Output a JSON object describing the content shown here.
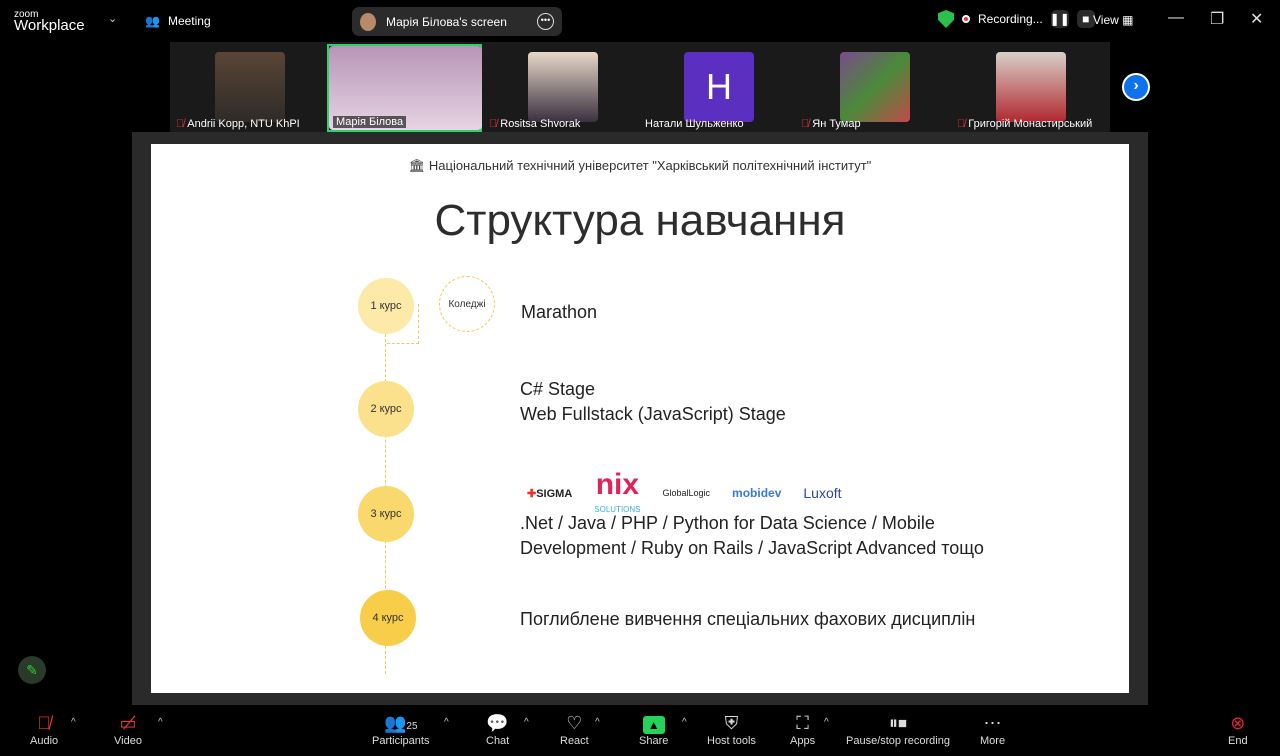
{
  "app": {
    "brand_small": "zoom",
    "brand_big": "Workplace",
    "meeting_label": "Meeting",
    "screen_label": "Марія Білова's screen",
    "recording_label": "Recording...",
    "view_label": "View"
  },
  "participants": [
    {
      "name": "Andrii Kopp, NTU KhPI",
      "muted": true,
      "initial": ""
    },
    {
      "name": "Марія Білова",
      "muted": false,
      "initial": ""
    },
    {
      "name": "Rositsa Shvorak",
      "muted": true,
      "initial": ""
    },
    {
      "name": "Натали Шульженко",
      "muted": false,
      "initial": "H"
    },
    {
      "name": "Ян Тумар",
      "muted": true,
      "initial": ""
    },
    {
      "name": "Григорій Монастирський",
      "muted": true,
      "initial": ""
    }
  ],
  "slide": {
    "university": "Національний технічний університет \"Харківський політехнічний інститут\"",
    "title": "Структура навчання",
    "courses": [
      "1 курс",
      "2 курс",
      "3 курс",
      "4 курс"
    ],
    "college": "Коледжі",
    "items": {
      "c1": "Marathon",
      "c2a": "C# Stage",
      "c2b": "Web Fullstack (JavaScript) Stage",
      "c3a": ".Net / Java / PHP / Python for Data Science / Mobile",
      "c3b": "Development / Ruby on Rails / JavaScript Advanced тощо",
      "c4": "Поглиблене вивчення спеціальних фахових дисциплін"
    },
    "logos": [
      "SIGMA",
      "nix",
      "SOLUTIONS",
      "GlobalLogic",
      "mobidev",
      "Luxoft"
    ]
  },
  "toolbar": {
    "audio": "Audio",
    "video": "Video",
    "participants": "Participants",
    "participants_count": "25",
    "chat": "Chat",
    "react": "React",
    "share": "Share",
    "host_tools": "Host tools",
    "apps": "Apps",
    "pause_stop": "Pause/stop recording",
    "more": "More",
    "end": "End"
  },
  "colors": {
    "accent": "#0e72ed",
    "share": "#23d35a",
    "end": "#e0243a",
    "circle1": "#fdeaa8",
    "circle4": "#f8cd4a"
  }
}
